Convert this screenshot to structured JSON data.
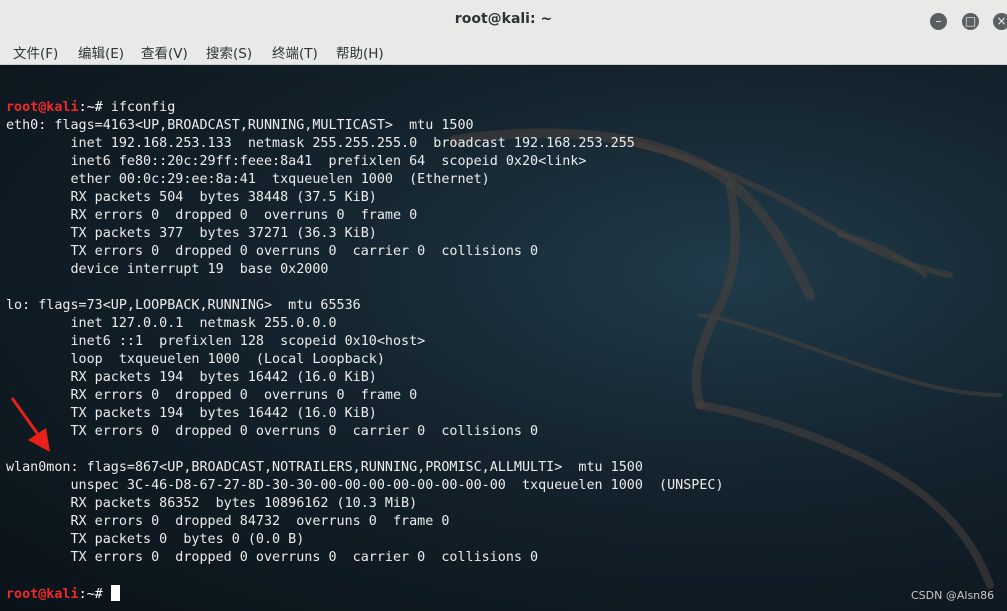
{
  "window": {
    "title": "root@kali: ~",
    "controls": {
      "minimize_icon": "minimize-icon",
      "maximize_icon": "maximize-icon",
      "close_icon": "close-icon"
    }
  },
  "menu": [
    "文件(F)",
    "编辑(E)",
    "查看(V)",
    "搜索(S)",
    "终端(T)",
    "帮助(H)"
  ],
  "prompt": {
    "user": "root@kali",
    "path": ":~# "
  },
  "command": "ifconfig",
  "output": [
    "eth0: flags=4163<UP,BROADCAST,RUNNING,MULTICAST>  mtu 1500",
    "        inet 192.168.253.133  netmask 255.255.255.0  broadcast 192.168.253.255",
    "        inet6 fe80::20c:29ff:feee:8a41  prefixlen 64  scopeid 0x20<link>",
    "        ether 00:0c:29:ee:8a:41  txqueuelen 1000  (Ethernet)",
    "        RX packets 504  bytes 38448 (37.5 KiB)",
    "        RX errors 0  dropped 0  overruns 0  frame 0",
    "        TX packets 377  bytes 37271 (36.3 KiB)",
    "        TX errors 0  dropped 0 overruns 0  carrier 0  collisions 0",
    "        device interrupt 19  base 0x2000",
    "",
    "lo: flags=73<UP,LOOPBACK,RUNNING>  mtu 65536",
    "        inet 127.0.0.1  netmask 255.0.0.0",
    "        inet6 ::1  prefixlen 128  scopeid 0x10<host>",
    "        loop  txqueuelen 1000  (Local Loopback)",
    "        RX packets 194  bytes 16442 (16.0 KiB)",
    "        RX errors 0  dropped 0  overruns 0  frame 0",
    "        TX packets 194  bytes 16442 (16.0 KiB)",
    "        TX errors 0  dropped 0 overruns 0  carrier 0  collisions 0",
    "",
    "wlan0mon: flags=867<UP,BROADCAST,NOTRAILERS,RUNNING,PROMISC,ALLMULTI>  mtu 1500",
    "        unspec 3C-46-D8-67-27-8D-30-30-00-00-00-00-00-00-00-00  txqueuelen 1000  (UNSPEC)",
    "        RX packets 86352  bytes 10896162 (10.3 MiB)",
    "        RX errors 0  dropped 84732  overruns 0  frame 0",
    "        TX packets 0  bytes 0 (0.0 B)",
    "        TX errors 0  dropped 0 overruns 0  carrier 0  collisions 0"
  ],
  "annotation": {
    "arrow_color": "#e8201a"
  },
  "watermark": "CSDN @Alsn86",
  "colors": {
    "prompt_user": "#ef2929",
    "terminal_text": "#ececec"
  }
}
